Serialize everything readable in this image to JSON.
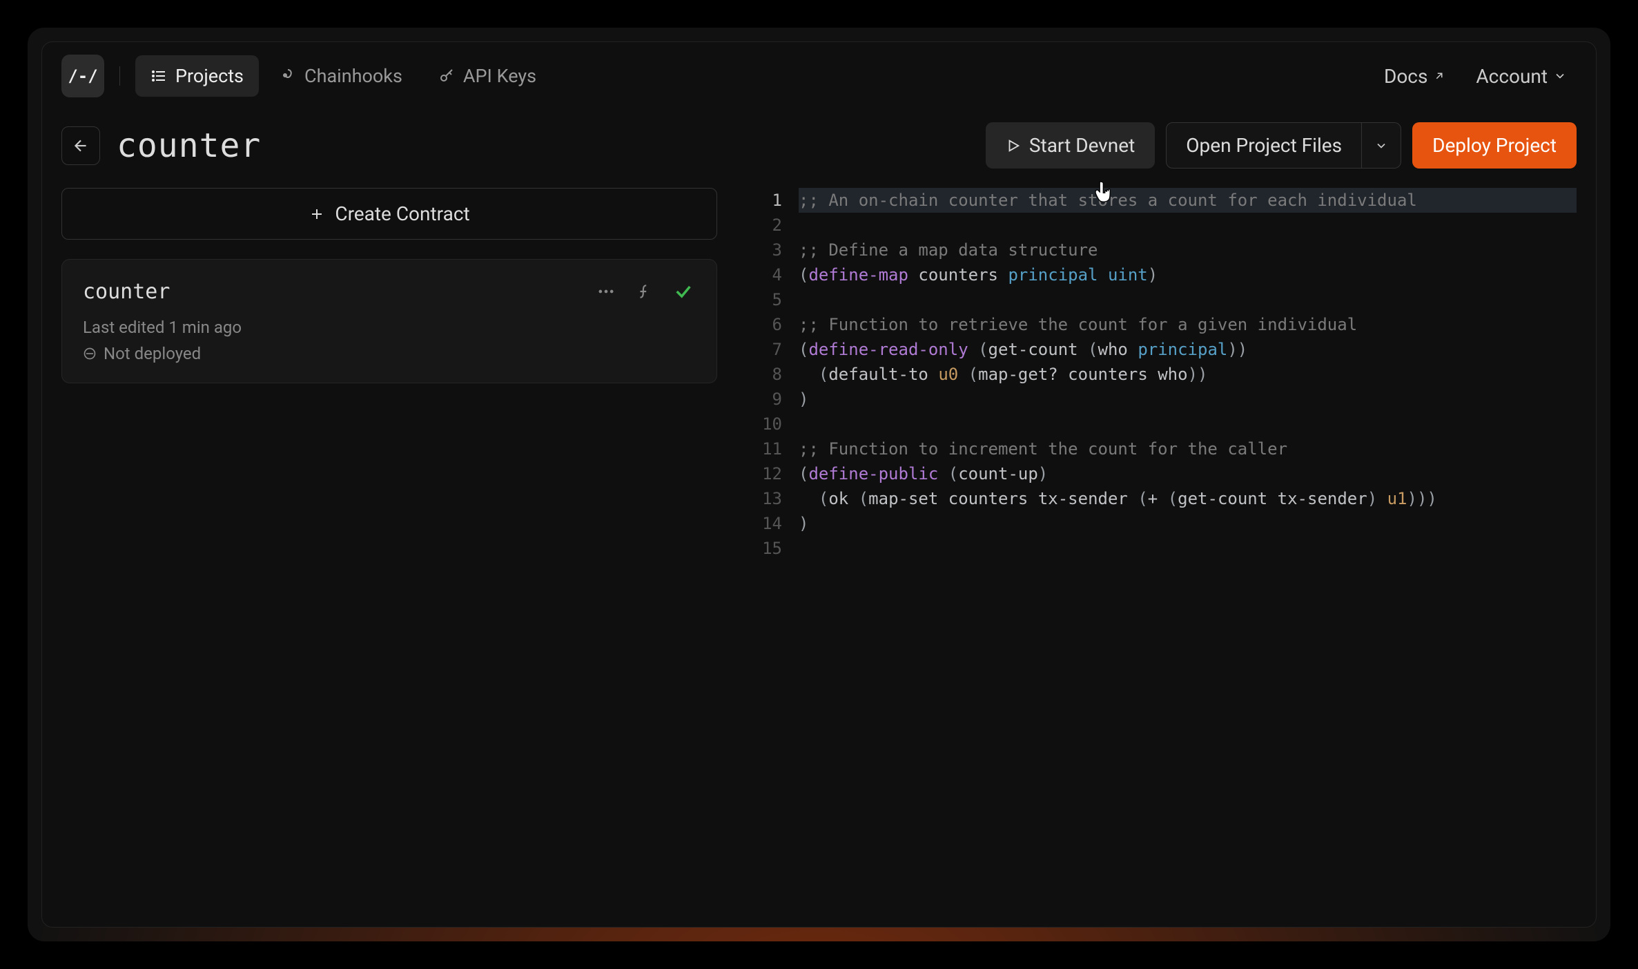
{
  "logo_text": "/-/",
  "nav": {
    "projects": "Projects",
    "chainhooks": "Chainhooks",
    "api_keys": "API Keys"
  },
  "toplinks": {
    "docs": "Docs",
    "account": "Account"
  },
  "project": {
    "title": "counter"
  },
  "actions": {
    "start_devnet": "Start Devnet",
    "open_files": "Open Project Files",
    "deploy": "Deploy Project"
  },
  "sidebar": {
    "create_contract": "Create Contract",
    "contract": {
      "name": "counter",
      "last_edited": "Last edited 1 min ago",
      "deploy_status": "Not deployed"
    }
  },
  "code": {
    "lines": [
      {
        "n": 1,
        "hl": true,
        "tokens": [
          {
            "c": "tk-comment",
            "t": ";; An on-chain counter that stores a count for each individual"
          }
        ]
      },
      {
        "n": 2,
        "tokens": []
      },
      {
        "n": 3,
        "tokens": [
          {
            "c": "tk-comment",
            "t": ";; Define a map data structure"
          }
        ]
      },
      {
        "n": 4,
        "tokens": [
          {
            "c": "tk-paren",
            "t": "("
          },
          {
            "c": "tk-kw",
            "t": "define-map"
          },
          {
            "c": "",
            "t": " "
          },
          {
            "c": "tk-name",
            "t": "counters"
          },
          {
            "c": "",
            "t": " "
          },
          {
            "c": "tk-type",
            "t": "principal"
          },
          {
            "c": "",
            "t": " "
          },
          {
            "c": "tk-type",
            "t": "uint"
          },
          {
            "c": "tk-paren",
            "t": ")"
          }
        ]
      },
      {
        "n": 5,
        "tokens": []
      },
      {
        "n": 6,
        "tokens": [
          {
            "c": "tk-comment",
            "t": ";; Function to retrieve the count for a given individual"
          }
        ]
      },
      {
        "n": 7,
        "tokens": [
          {
            "c": "tk-paren",
            "t": "("
          },
          {
            "c": "tk-kw",
            "t": "define-read-only"
          },
          {
            "c": "",
            "t": " "
          },
          {
            "c": "tk-paren",
            "t": "("
          },
          {
            "c": "tk-fn",
            "t": "get-count"
          },
          {
            "c": "",
            "t": " "
          },
          {
            "c": "tk-paren",
            "t": "("
          },
          {
            "c": "tk-var",
            "t": "who"
          },
          {
            "c": "",
            "t": " "
          },
          {
            "c": "tk-type",
            "t": "principal"
          },
          {
            "c": "tk-paren",
            "t": "))"
          }
        ]
      },
      {
        "n": 8,
        "tokens": [
          {
            "c": "",
            "t": "  "
          },
          {
            "c": "tk-paren",
            "t": "("
          },
          {
            "c": "tk-fn",
            "t": "default-to"
          },
          {
            "c": "",
            "t": " "
          },
          {
            "c": "tk-num",
            "t": "u0"
          },
          {
            "c": "",
            "t": " "
          },
          {
            "c": "tk-paren",
            "t": "("
          },
          {
            "c": "tk-fn",
            "t": "map-get?"
          },
          {
            "c": "",
            "t": " "
          },
          {
            "c": "tk-name",
            "t": "counters"
          },
          {
            "c": "",
            "t": " "
          },
          {
            "c": "tk-var",
            "t": "who"
          },
          {
            "c": "tk-paren",
            "t": "))"
          }
        ]
      },
      {
        "n": 9,
        "tokens": [
          {
            "c": "tk-paren",
            "t": ")"
          }
        ]
      },
      {
        "n": 10,
        "tokens": []
      },
      {
        "n": 11,
        "tokens": [
          {
            "c": "tk-comment",
            "t": ";; Function to increment the count for the caller"
          }
        ]
      },
      {
        "n": 12,
        "tokens": [
          {
            "c": "tk-paren",
            "t": "("
          },
          {
            "c": "tk-kw",
            "t": "define-public"
          },
          {
            "c": "",
            "t": " "
          },
          {
            "c": "tk-paren",
            "t": "("
          },
          {
            "c": "tk-fn",
            "t": "count-up"
          },
          {
            "c": "tk-paren",
            "t": ")"
          }
        ]
      },
      {
        "n": 13,
        "tokens": [
          {
            "c": "",
            "t": "  "
          },
          {
            "c": "tk-paren",
            "t": "("
          },
          {
            "c": "tk-fn",
            "t": "ok"
          },
          {
            "c": "",
            "t": " "
          },
          {
            "c": "tk-paren",
            "t": "("
          },
          {
            "c": "tk-fn",
            "t": "map-set"
          },
          {
            "c": "",
            "t": " "
          },
          {
            "c": "tk-name",
            "t": "counters"
          },
          {
            "c": "",
            "t": " "
          },
          {
            "c": "tk-var",
            "t": "tx-sender"
          },
          {
            "c": "",
            "t": " "
          },
          {
            "c": "tk-paren",
            "t": "("
          },
          {
            "c": "tk-fn",
            "t": "+"
          },
          {
            "c": "",
            "t": " "
          },
          {
            "c": "tk-paren",
            "t": "("
          },
          {
            "c": "tk-fn",
            "t": "get-count"
          },
          {
            "c": "",
            "t": " "
          },
          {
            "c": "tk-var",
            "t": "tx-sender"
          },
          {
            "c": "tk-paren",
            "t": ")"
          },
          {
            "c": "",
            "t": " "
          },
          {
            "c": "tk-num",
            "t": "u1"
          },
          {
            "c": "tk-paren",
            "t": ")))"
          }
        ]
      },
      {
        "n": 14,
        "tokens": [
          {
            "c": "tk-paren",
            "t": ")"
          }
        ]
      },
      {
        "n": 15,
        "tokens": []
      }
    ]
  }
}
